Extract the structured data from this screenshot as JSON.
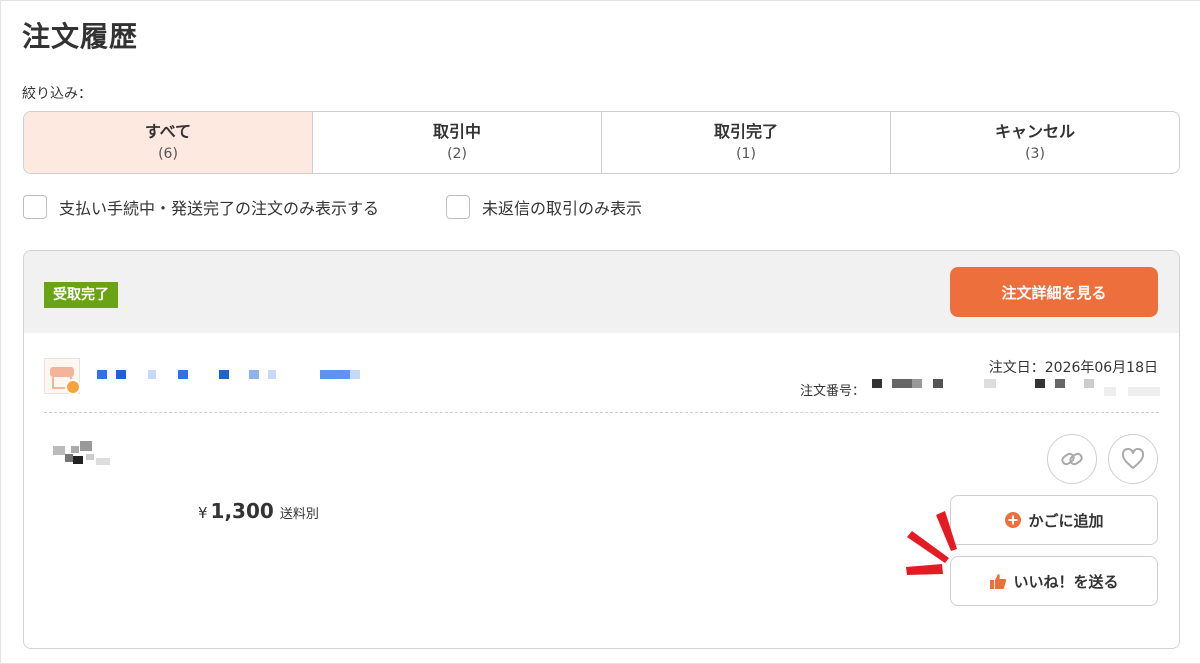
{
  "page": {
    "title": "注文履歴"
  },
  "filter": {
    "label": "絞り込み：",
    "tabs": [
      {
        "label": "すべて",
        "count": "(6)",
        "active": true
      },
      {
        "label": "取引中",
        "count": "(2)",
        "active": false
      },
      {
        "label": "取引完了",
        "count": "(1)",
        "active": false
      },
      {
        "label": "キャンセル",
        "count": "(3)",
        "active": false
      }
    ],
    "checkboxes": [
      {
        "label": "支払い手続中・発送完了の注文のみ表示する",
        "checked": false
      },
      {
        "label": "未返信の取引のみ表示",
        "checked": false
      }
    ]
  },
  "order": {
    "status": "受取完了",
    "detail_button": "注文詳細を見る",
    "order_date": "注文日：2026年06月18日",
    "order_number_label": "注文番号：",
    "price_symbol": "¥",
    "price": "1,300",
    "price_note": "送料別",
    "actions": {
      "add_to_cart": "かごに追加",
      "send_like": "いいね！を送る"
    }
  },
  "colors": {
    "accent": "#ec6f3c",
    "status_green": "#6aa314",
    "active_tab_bg": "#fde9e0",
    "header_bg": "#f1f1f1",
    "highlight_red": "#e41b23"
  },
  "icons": {
    "shop": "shop-icon",
    "link": "link-icon",
    "favorite": "heart-icon",
    "add_to_cart": "plus-circle-icon",
    "like": "thumbs-up-icon"
  }
}
